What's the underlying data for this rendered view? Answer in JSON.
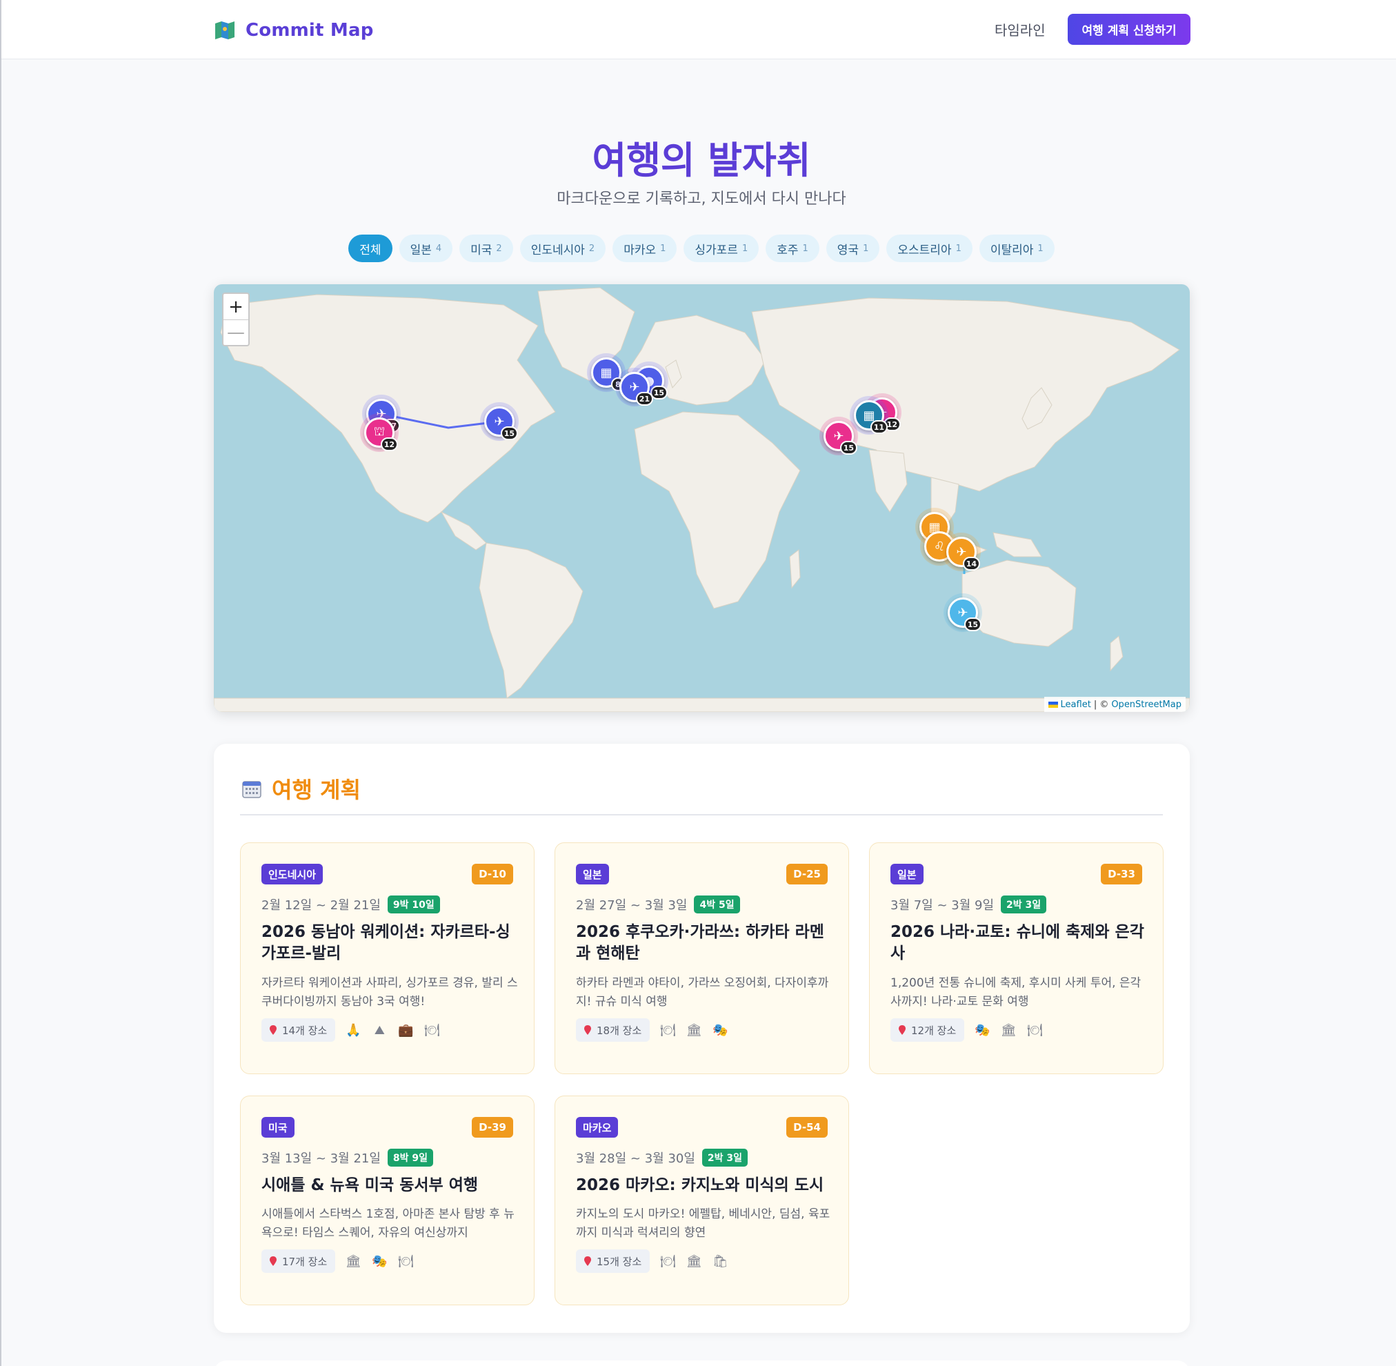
{
  "header": {
    "brand": "Commit Map",
    "nav_timeline": "타임라인",
    "cta": "여행 계획 신청하기"
  },
  "hero": {
    "title": "여행의 발자취",
    "subtitle": "마크다운으로 기록하고, 지도에서 다시 만나다"
  },
  "filters": [
    {
      "label": "전체",
      "count": "",
      "active": true
    },
    {
      "label": "일본",
      "count": "4"
    },
    {
      "label": "미국",
      "count": "2"
    },
    {
      "label": "인도네시아",
      "count": "2"
    },
    {
      "label": "마카오",
      "count": "1"
    },
    {
      "label": "싱가포르",
      "count": "1"
    },
    {
      "label": "호주",
      "count": "1"
    },
    {
      "label": "영국",
      "count": "1"
    },
    {
      "label": "오스트리아",
      "count": "1"
    },
    {
      "label": "이탈리아",
      "count": "1"
    }
  ],
  "map": {
    "zoom_in": "+",
    "zoom_out": "—",
    "attribution_leaflet": "Leaflet",
    "attribution_sep": "| ©",
    "attribution_osm": "OpenStreetMap",
    "markers": [
      {
        "name": "seattle",
        "badge": "17",
        "color": "blue",
        "icon": "plane-icon"
      },
      {
        "name": "sanfrancisco",
        "badge": "12",
        "color": "pink",
        "icon": "museum-icon"
      },
      {
        "name": "newyork",
        "badge": "15",
        "color": "blue",
        "icon": "plane-icon"
      },
      {
        "name": "london",
        "badge": "8",
        "color": "blue",
        "icon": "building-icon"
      },
      {
        "name": "vienna",
        "badge": "15",
        "color": "blue",
        "icon": "hat-icon"
      },
      {
        "name": "italy",
        "badge": "21",
        "color": "blue",
        "icon": "plane-icon"
      },
      {
        "name": "japan-1",
        "badge": "11",
        "color": "teal",
        "icon": "building-icon"
      },
      {
        "name": "japan-2",
        "badge": "12",
        "color": "pink",
        "icon": "plane-icon"
      },
      {
        "name": "macau",
        "badge": "15",
        "color": "pink",
        "icon": "plane-icon"
      },
      {
        "name": "singapore",
        "badge": "",
        "color": "orange",
        "icon": "building-icon"
      },
      {
        "name": "jakarta",
        "badge": "",
        "color": "orange",
        "icon": "lion-icon"
      },
      {
        "name": "bali",
        "badge": "14",
        "color": "orange",
        "icon": "plane-icon"
      },
      {
        "name": "perth",
        "badge": "15",
        "color": "sky",
        "icon": "plane-icon"
      }
    ]
  },
  "plans": {
    "title": "여행 계획",
    "cards": [
      {
        "country": "인도네시아",
        "dday": "D-10",
        "dates": "2월 12일 ~ 2월 21일",
        "nights": "9박 10일",
        "title": "2026 동남아 워케이션: 자카르타-싱가포르-발리",
        "desc": "자카르타 워케이션과 사파리, 싱가포르 경유, 발리 스쿠버다이빙까지 동남아 3국 여행!",
        "places": "14개 장소",
        "cats": [
          "temple-icon",
          "nature-icon",
          "briefcase-icon",
          "dining-icon"
        ]
      },
      {
        "country": "일본",
        "dday": "D-25",
        "dates": "2월 27일 ~ 3월 3일",
        "nights": "4박 5일",
        "title": "2026 후쿠오카·가라쓰: 하카타 라멘과 현해탄",
        "desc": "하카타 라멘과 야타이, 가라쓰 오징어회, 다자이후까지! 규슈 미식 여행",
        "places": "18개 장소",
        "cats": [
          "dining-icon",
          "museum-icon",
          "theater-icon"
        ]
      },
      {
        "country": "일본",
        "dday": "D-33",
        "dates": "3월 7일 ~ 3월 9일",
        "nights": "2박 3일",
        "title": "2026 나라·교토: 슈니에 축제와 은각사",
        "desc": "1,200년 전통 슈니에 축제, 후시미 사케 투어, 은각사까지! 나라·교토 문화 여행",
        "places": "12개 장소",
        "cats": [
          "theater-icon",
          "museum-icon",
          "dining-icon"
        ]
      },
      {
        "country": "미국",
        "dday": "D-39",
        "dates": "3월 13일 ~ 3월 21일",
        "nights": "8박 9일",
        "title": "시애틀 & 뉴욕 미국 동서부 여행",
        "desc": "시애틀에서 스타벅스 1호점, 아마존 본사 탐방 후 뉴욕으로! 타임스 스퀘어, 자유의 여신상까지",
        "places": "17개 장소",
        "cats": [
          "museum-icon",
          "theater-icon",
          "dining-icon"
        ]
      },
      {
        "country": "마카오",
        "dday": "D-54",
        "dates": "3월 28일 ~ 3월 30일",
        "nights": "2박 3일",
        "title": "2026 마카오: 카지노와 미식의 도시",
        "desc": "카지노의 도시 마카오! 에펠탑, 베네시안, 딤섬, 육포까지 미식과 럭셔리의 향연",
        "places": "15개 장소",
        "cats": [
          "dining-icon",
          "museum-icon",
          "shopping-icon"
        ]
      }
    ]
  },
  "colors": {
    "brand": "#5a3fd6",
    "accent_orange": "#f08c0f",
    "chip_active": "#1e9bd7",
    "dday": "#f09a1e",
    "nights": "#1aa36b",
    "ocean": "#aad3df",
    "land": "#f2efe9"
  }
}
